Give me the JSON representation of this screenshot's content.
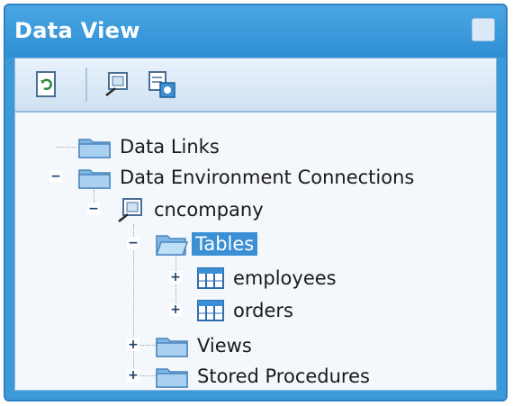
{
  "window": {
    "title": "Data View"
  },
  "toolbar": {
    "buttons": [
      {
        "icon": "refresh-icon"
      },
      {
        "icon": "connection-icon"
      },
      {
        "icon": "properties-icon"
      }
    ]
  },
  "tree": {
    "items": [
      {
        "label": "Data Links",
        "level": 1,
        "expander": "",
        "icon": "folder-icon"
      },
      {
        "label": "Data Environment Connections",
        "level": 1,
        "expander": "−",
        "icon": "folder-icon"
      },
      {
        "label": "cncompany",
        "level": 2,
        "expander": "−",
        "icon": "connection-icon"
      },
      {
        "label": "Tables",
        "level": 3,
        "expander": "−",
        "icon": "folder-open-icon",
        "selected": true
      },
      {
        "label": "employees",
        "level": 4,
        "expander": "+",
        "icon": "table-icon"
      },
      {
        "label": "orders",
        "level": 4,
        "expander": "+",
        "icon": "table-icon"
      },
      {
        "label": "Views",
        "level": 3,
        "expander": "+",
        "icon": "folder-icon"
      },
      {
        "label": "Stored Procedures",
        "level": 3,
        "expander": "+",
        "icon": "folder-icon"
      }
    ]
  },
  "colors": {
    "title_bar": "#3d9ad9",
    "selection": "#3b8fd4",
    "folder": "#7fb6e4"
  }
}
